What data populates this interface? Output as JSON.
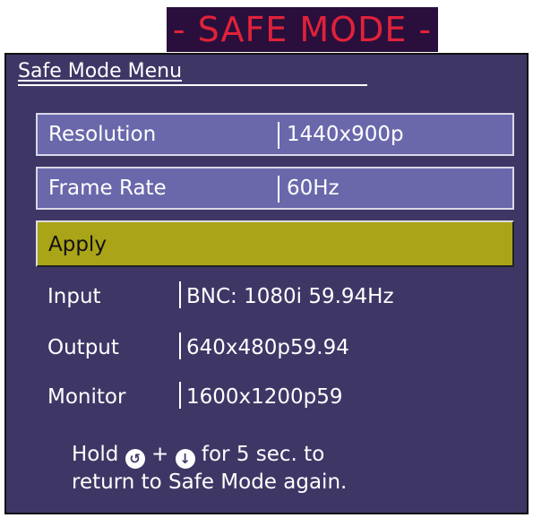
{
  "banner": {
    "text": "- SAFE MODE -"
  },
  "menu": {
    "title": "Safe Mode Menu",
    "rows": [
      {
        "label": "Resolution",
        "value": "1440x900p"
      },
      {
        "label": "Frame Rate",
        "value": "60Hz"
      }
    ],
    "apply_label": "Apply"
  },
  "status": [
    {
      "label": "Input",
      "value": "BNC: 1080i 59.94Hz"
    },
    {
      "label": "Output",
      "value": "640x480p59.94"
    },
    {
      "label": "Monitor",
      "value": "1600x1200p59"
    }
  ],
  "hint": {
    "prefix": "Hold",
    "plus": "+",
    "suffix": "for 5 sec. to",
    "line2": "return to Safe Mode again.",
    "icon1": "rotate-icon",
    "icon2": "down-arrow-icon"
  },
  "colors": {
    "panel": "#3e3766",
    "row": "#6a68ab",
    "apply": "#aaa418",
    "banner_bg": "#2a0f3c",
    "banner_text": "#e0223a"
  }
}
